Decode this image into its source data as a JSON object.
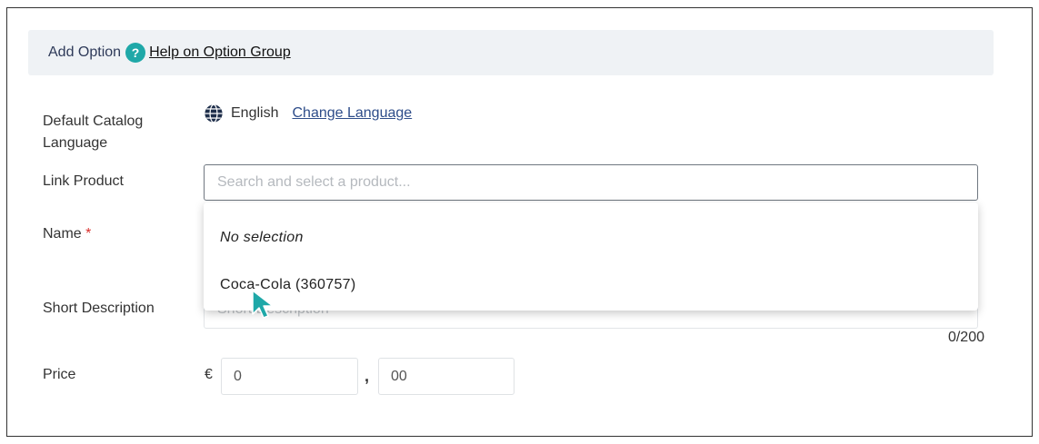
{
  "header": {
    "title": "Add Option",
    "help_icon_glyph": "?",
    "help_link": "Help on Option Group"
  },
  "form": {
    "default_language": {
      "label": "Default Catalog Language",
      "icon": "globe-icon",
      "value": "English",
      "change_link": "Change Language"
    },
    "link_product": {
      "label": "Link Product",
      "placeholder": "Search and select a product...",
      "value": ""
    },
    "name": {
      "label": "Name",
      "required_mark": "*"
    },
    "short_description": {
      "label": "Short Description",
      "placeholder": "Short Description",
      "counter": "0/200"
    },
    "price": {
      "label": "Price",
      "currency": "€",
      "main_value": "0",
      "separator": ",",
      "cents_value": "00"
    }
  },
  "dropdown": {
    "options": [
      {
        "label": "No selection"
      },
      {
        "label": "Coca-Cola (360757)"
      }
    ]
  },
  "colors": {
    "accent_teal": "#1fa8a8",
    "link_blue": "#2e4d8a",
    "header_bg": "#eff2f5",
    "required_red": "#d9302c"
  }
}
